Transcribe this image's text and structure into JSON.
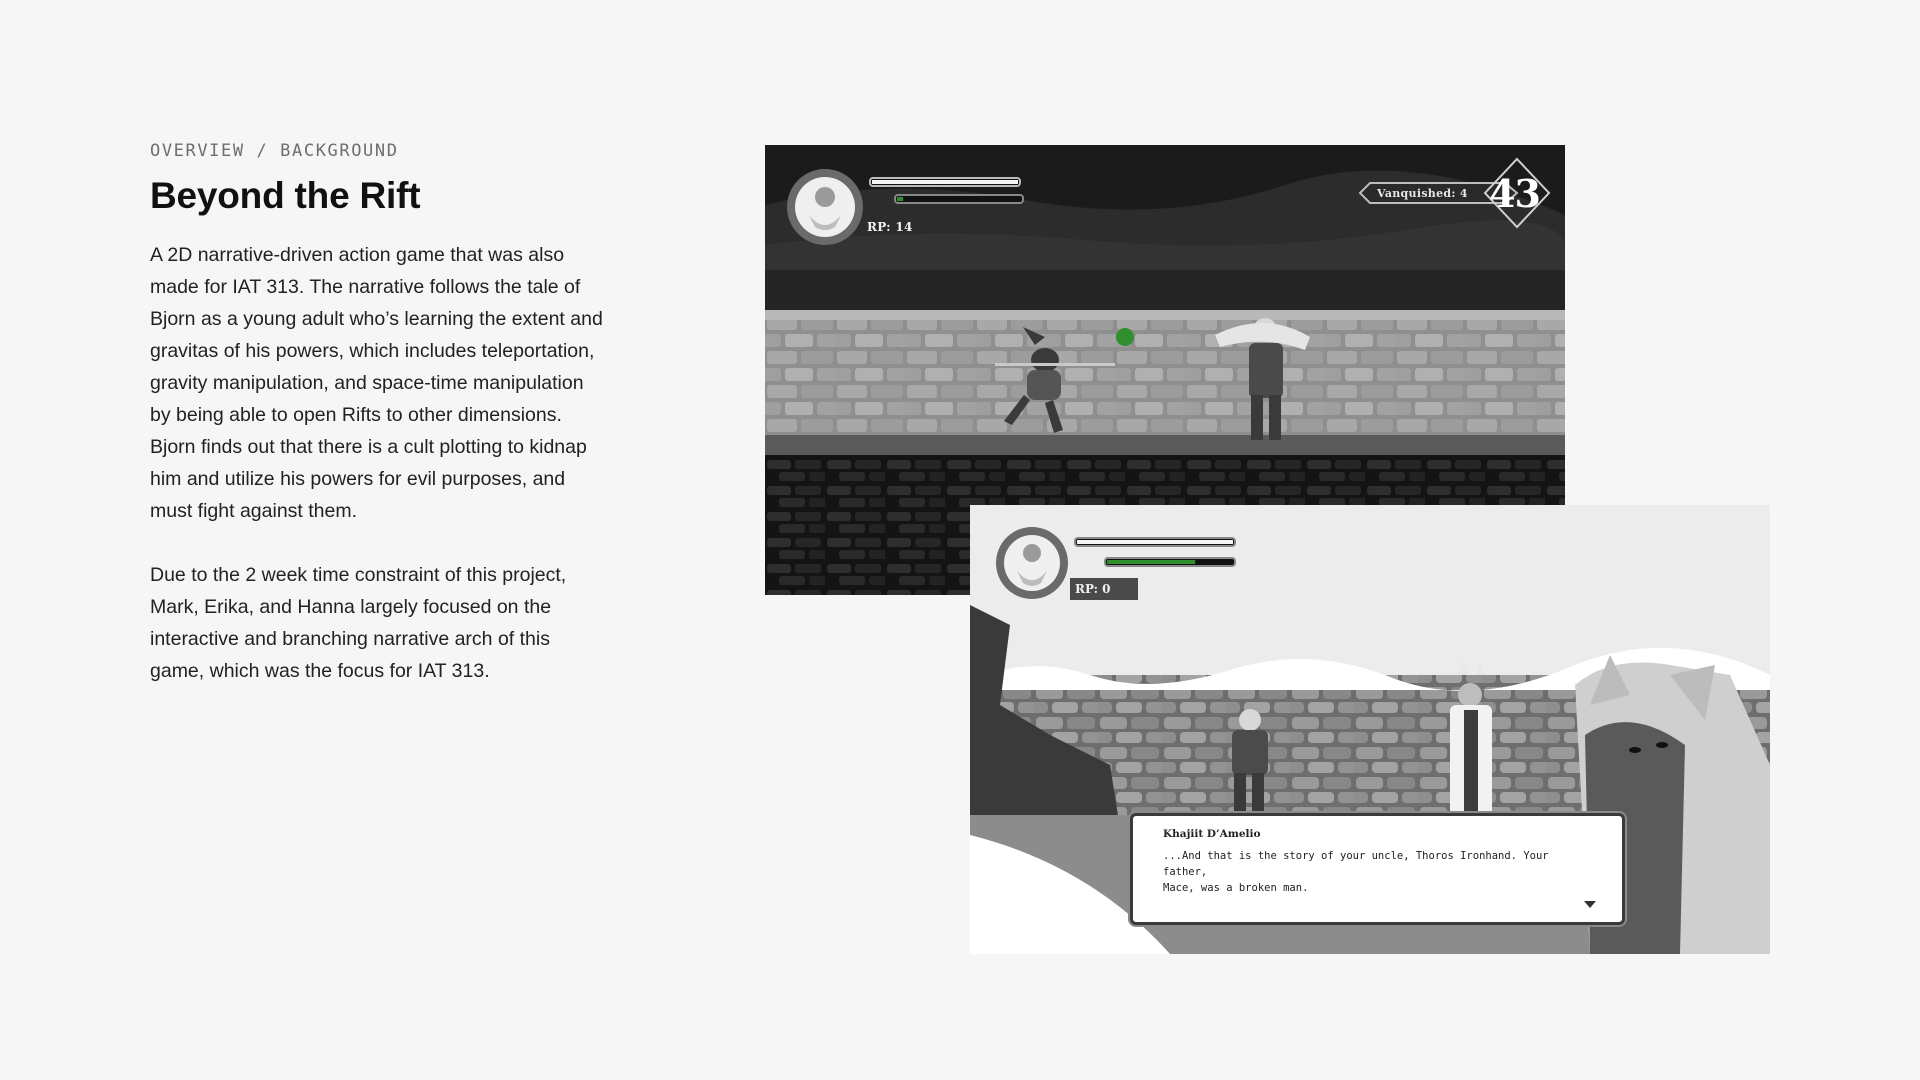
{
  "overview": {
    "eyebrow": "OVERVIEW / BACKGROUND",
    "title": "Beyond the Rift",
    "paragraphs": [
      "A 2D narrative-driven action game that was also made for IAT 313. The narrative follows the tale of Bjorn as a young adult who’s learning the extent and gravitas of his powers, which includes teleportation, gravity manipulation, and space-time manipulation by being able to open Rifts to other dimensions. Bjorn finds out that there is a cult plotting to kidnap him and utilize his powers for evil purposes, and must fight against them.",
      "Due to the 2 week time constraint of this project, Mark, Erika, and Hanna largely focused on the interactive and branching narrative arch of this game, which was the focus for IAT 313."
    ]
  },
  "battle_screen": {
    "rp_label": "RP: 14",
    "vanquished_label": "Vanquished: 4",
    "score": "43",
    "health_fraction": 1.0,
    "rift_fraction": 0.05
  },
  "dialogue_screen": {
    "rp_label": "RP: 0",
    "health_fraction": 1.0,
    "rift_fraction": 0.7,
    "speaker": "Khajiit D’Amelio",
    "lines": [
      "...And that is the story of your uncle, Thoros Ironhand. Your father,",
      "Mace, was a broken man."
    ]
  },
  "colors": {
    "background": "#f6f6f6",
    "rift_green": "#2f8f2f"
  }
}
